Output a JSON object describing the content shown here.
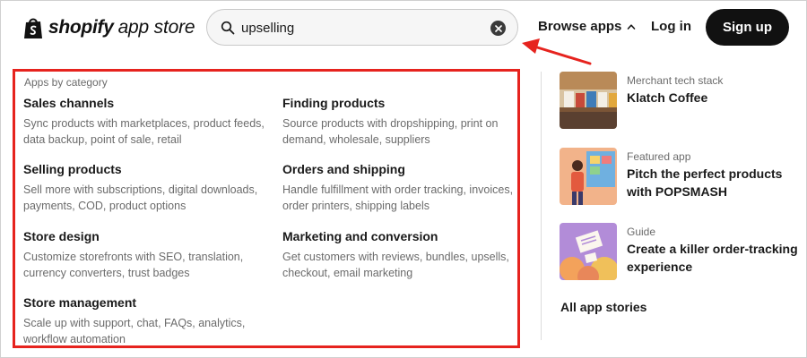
{
  "header": {
    "logo_strong": "shopify",
    "logo_light": "app store",
    "search": {
      "value": "upselling",
      "icon": "search-icon",
      "clear_icon": "clear-icon"
    },
    "browse_label": "Browse apps",
    "login_label": "Log in",
    "signup_label": "Sign up"
  },
  "categories": {
    "heading": "Apps by category",
    "items": [
      {
        "title": "Sales channels",
        "desc": "Sync products with marketplaces, product feeds, data backup, point of sale, retail"
      },
      {
        "title": "Finding products",
        "desc": "Source products with dropshipping, print on demand, wholesale, suppliers"
      },
      {
        "title": "Selling products",
        "desc": "Sell more with subscriptions, digital downloads, payments, COD, product options"
      },
      {
        "title": "Orders and shipping",
        "desc": "Handle fulfillment with order tracking, invoices, order printers, shipping labels"
      },
      {
        "title": "Store design",
        "desc": "Customize storefronts with SEO, translation, currency converters, trust badges"
      },
      {
        "title": "Marketing and conversion",
        "desc": "Get customers with reviews, bundles, upsells, checkout, email marketing"
      },
      {
        "title": "Store management",
        "desc": "Scale up with support, chat, FAQs, analytics, workflow automation"
      }
    ]
  },
  "stories": {
    "items": [
      {
        "label": "Merchant tech stack",
        "title": "Klatch Coffee"
      },
      {
        "label": "Featured app",
        "title": "Pitch the perfect products with POPSMASH"
      },
      {
        "label": "Guide",
        "title": "Create a killer order-tracking experience"
      }
    ],
    "all_label": "All app stories"
  },
  "colors": {
    "annotation_red": "#e6231e",
    "primary_dark": "#111111",
    "muted_text": "#6b6b6b"
  }
}
